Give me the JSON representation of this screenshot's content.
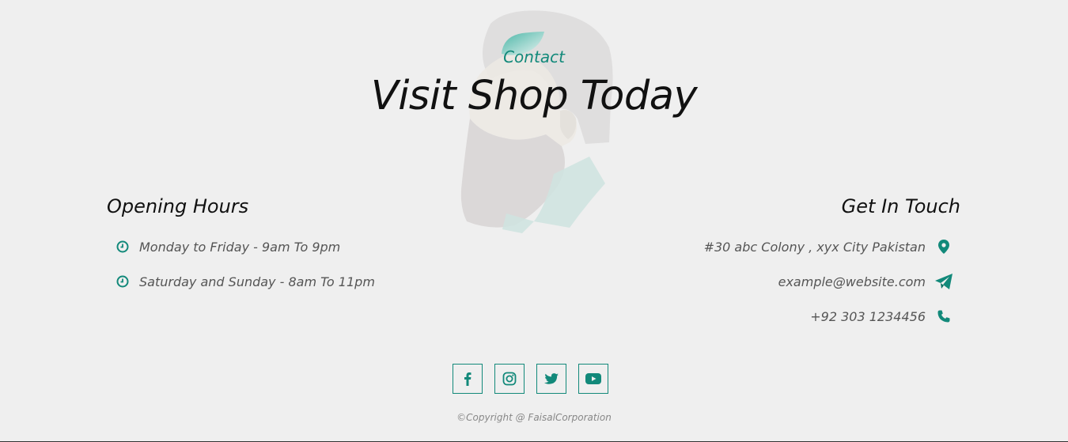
{
  "colors": {
    "accent": "#12897a",
    "background": "#efefef",
    "heading": "#111111",
    "body_text": "#555555"
  },
  "header": {
    "eyebrow": "Contact",
    "title": "Visit Shop Today"
  },
  "opening_hours": {
    "heading": "Opening Hours",
    "items": [
      {
        "icon": "clock-icon",
        "text": "Monday to Friday - 9am To 9pm"
      },
      {
        "icon": "clock-icon",
        "text": "Saturday and Sunday - 8am To 11pm"
      }
    ]
  },
  "get_in_touch": {
    "heading": "Get In Touch",
    "items": [
      {
        "icon": "map-pin-icon",
        "text": "#30 abc Colony , xyx City Pakistan"
      },
      {
        "icon": "paper-plane-icon",
        "text": "example@website.com"
      },
      {
        "icon": "phone-icon",
        "text": "+92 303 1234456"
      }
    ]
  },
  "socials": [
    {
      "icon": "facebook-icon",
      "label": "Facebook"
    },
    {
      "icon": "instagram-icon",
      "label": "Instagram"
    },
    {
      "icon": "twitter-icon",
      "label": "Twitter"
    },
    {
      "icon": "youtube-icon",
      "label": "YouTube"
    }
  ],
  "footer": {
    "copyright": "©Copyright @ FaisalCorporation"
  }
}
